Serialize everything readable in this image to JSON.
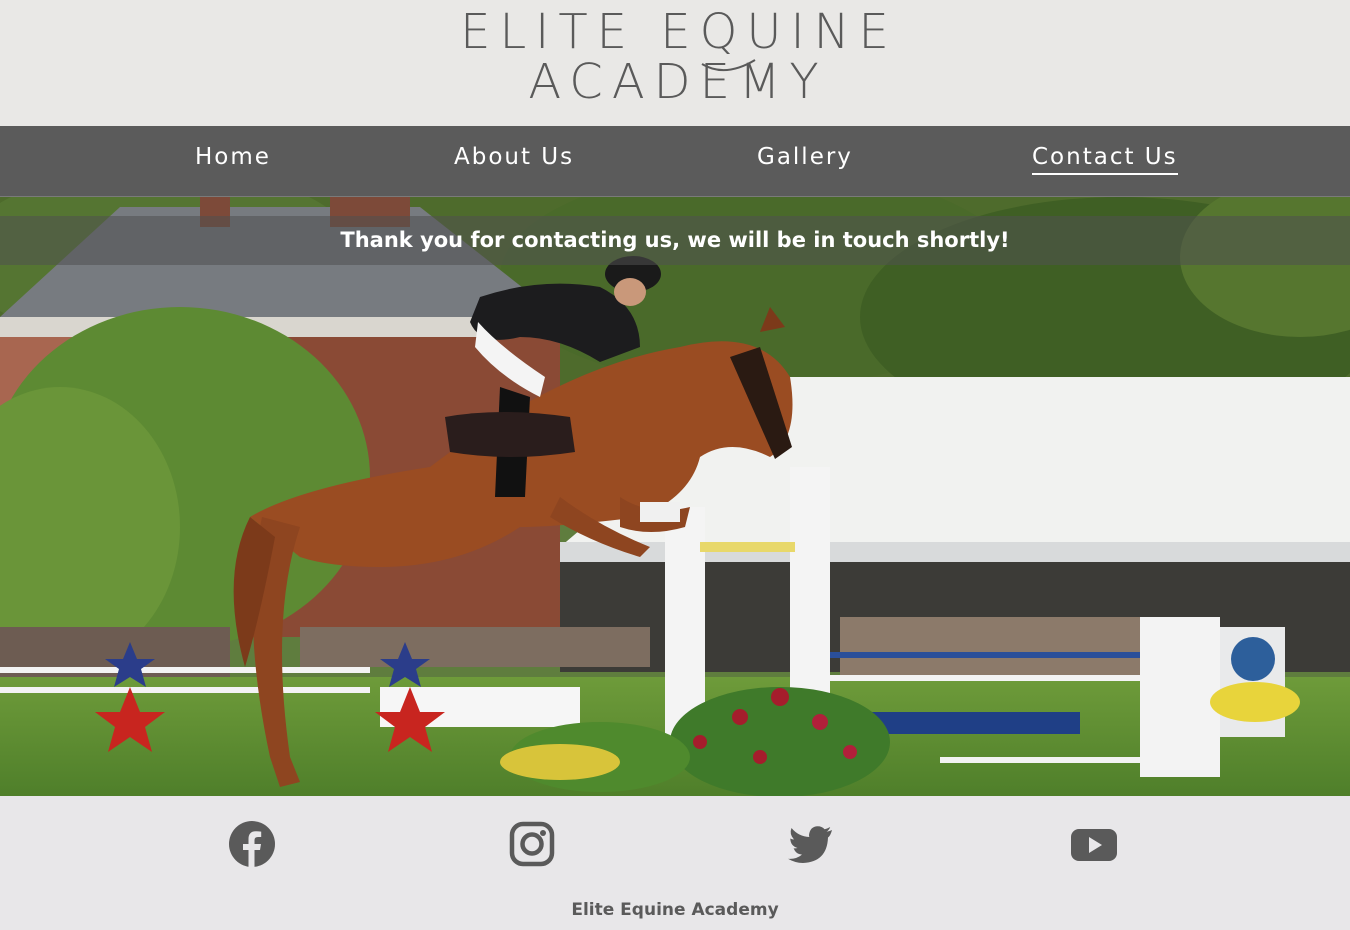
{
  "header": {
    "logo_line1": "ELITE EQUINE",
    "logo_line2": "ACADEMY"
  },
  "nav": {
    "items": [
      {
        "label": "Home"
      },
      {
        "label": "About Us"
      },
      {
        "label": "Gallery"
      },
      {
        "label": "Contact Us",
        "active": true
      }
    ]
  },
  "hero": {
    "notice": "Thank you for contacting us, we will be in touch shortly!",
    "image_description_icon": "horse-jumping-photo"
  },
  "footer": {
    "social": [
      {
        "icon": "facebook-icon"
      },
      {
        "icon": "instagram-icon"
      },
      {
        "icon": "twitter-icon"
      },
      {
        "icon": "youtube-icon"
      }
    ],
    "text": "Elite Equine Academy"
  },
  "colors": {
    "nav_bg": "#5b5b5b",
    "header_bg": "#e9e8e6",
    "footer_bg": "#e8e7e9",
    "logo_text": "#5a5a5a",
    "icon": "#5a5a5a"
  }
}
